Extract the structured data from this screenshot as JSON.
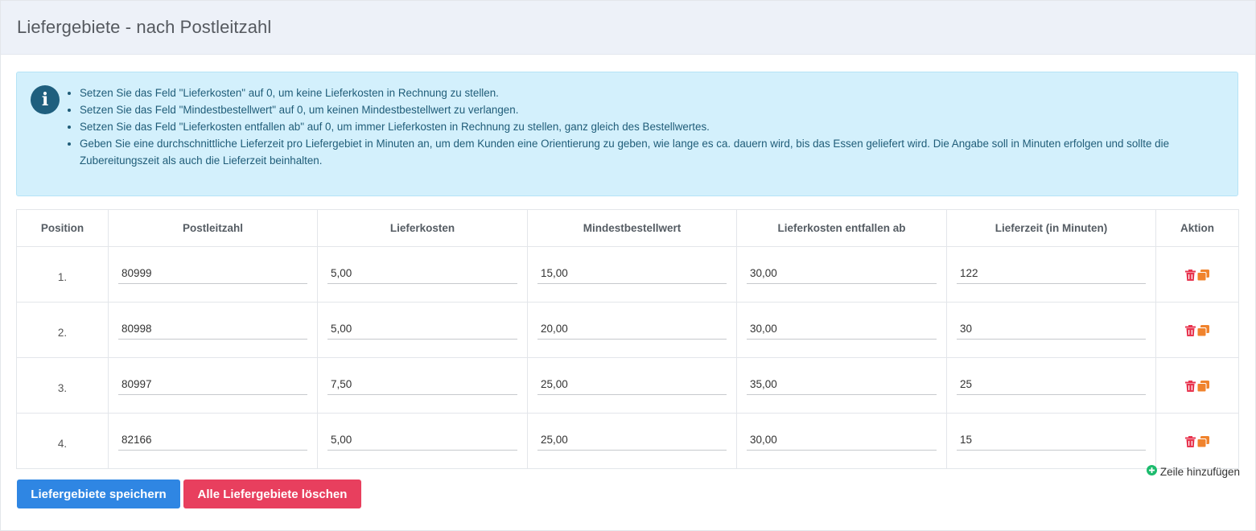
{
  "header": {
    "title": "Liefergebiete - nach Postleitzahl"
  },
  "info": {
    "icon": "info-icon",
    "items": [
      "Setzen Sie das Feld \"Lieferkosten\" auf 0, um keine Lieferkosten in Rechnung zu stellen.",
      "Setzen Sie das Feld \"Mindestbestellwert\" auf 0, um keinen Mindestbestellwert zu verlangen.",
      "Setzen Sie das Feld \"Lieferkosten entfallen ab\" auf 0, um immer Lieferkosten in Rechnung zu stellen, ganz gleich des Bestellwertes.",
      "Geben Sie eine durchschnittliche Lieferzeit pro Liefergebiet in Minuten an, um dem Kunden eine Orientierung zu geben, wie lange es ca. dauern wird, bis das Essen geliefert wird. Die Angabe soll in Minuten erfolgen und sollte die Zubereitungszeit als auch die Lieferzeit beinhalten."
    ]
  },
  "table": {
    "columns": [
      "Position",
      "Postleitzahl",
      "Lieferkosten",
      "Mindestbestellwert",
      "Lieferkosten entfallen ab",
      "Lieferzeit (in Minuten)",
      "Aktion"
    ],
    "rows": [
      {
        "position": "1.",
        "plz": "80999",
        "lieferkosten": "5,00",
        "mindestbestellwert": "15,00",
        "entfallen_ab": "30,00",
        "lieferzeit": "122"
      },
      {
        "position": "2.",
        "plz": "80998",
        "lieferkosten": "5,00",
        "mindestbestellwert": "20,00",
        "entfallen_ab": "30,00",
        "lieferzeit": "30"
      },
      {
        "position": "3.",
        "plz": "80997",
        "lieferkosten": "7,50",
        "mindestbestellwert": "25,00",
        "entfallen_ab": "35,00",
        "lieferzeit": "25"
      },
      {
        "position": "4.",
        "plz": "82166",
        "lieferkosten": "5,00",
        "mindestbestellwert": "25,00",
        "entfallen_ab": "30,00",
        "lieferzeit": "15"
      }
    ],
    "action_icons": [
      "trash-icon",
      "copy-icon"
    ]
  },
  "add_row": {
    "label": "Zeile hinzufügen",
    "icon": "plus-circle-icon"
  },
  "buttons": {
    "save_label": "Liefergebiete speichern",
    "delete_all_label": "Alle Liefergebiete löschen"
  },
  "colors": {
    "header_bg": "#edf1f8",
    "info_bg": "#d3f0fc",
    "info_text": "#1f5c78",
    "save_button": "#2f86e3",
    "delete_button": "#e83f5e",
    "trash_icon": "#e8354f",
    "copy_icon": "#f0832d",
    "add_icon": "#1cbb6d"
  }
}
